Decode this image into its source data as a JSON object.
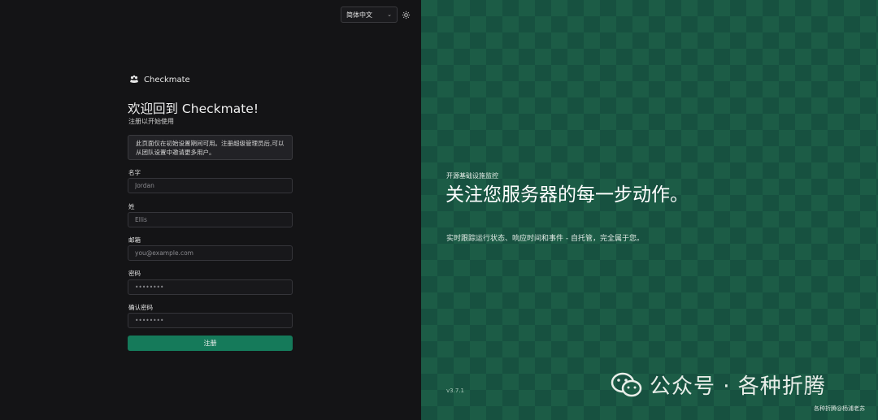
{
  "header": {
    "language_selected": "简体中文"
  },
  "brand": {
    "name": "Checkmate"
  },
  "form": {
    "title": "欢迎回到 Checkmate!",
    "subtitle": "注册以开始使用",
    "notice": "此页面仅在初始设置期间可用。注册超级管理员后,可以从团队设置中邀请更多用户。",
    "fields": [
      {
        "label": "名字",
        "placeholder": "Jordan"
      },
      {
        "label": "姓",
        "placeholder": "Ellis"
      },
      {
        "label": "邮箱",
        "placeholder": "you@example.com"
      },
      {
        "label": "密码",
        "placeholder": "••••••••"
      },
      {
        "label": "确认密码",
        "placeholder": "••••••••"
      }
    ],
    "submit_label": "注册"
  },
  "hero": {
    "eyebrow": "开源基础设施监控",
    "title": "关注您服务器的每一步动作。",
    "description": "实时跟踪运行状态、响应时间和事件 - 自托管，完全属于您。",
    "version": "v3.7.1"
  },
  "watermark": {
    "text": "公众号 · 各种折腾",
    "small": "各种折腾@杨浦老苏"
  },
  "colors": {
    "accent": "#157a5a",
    "panel_green": "#1c5c46"
  }
}
